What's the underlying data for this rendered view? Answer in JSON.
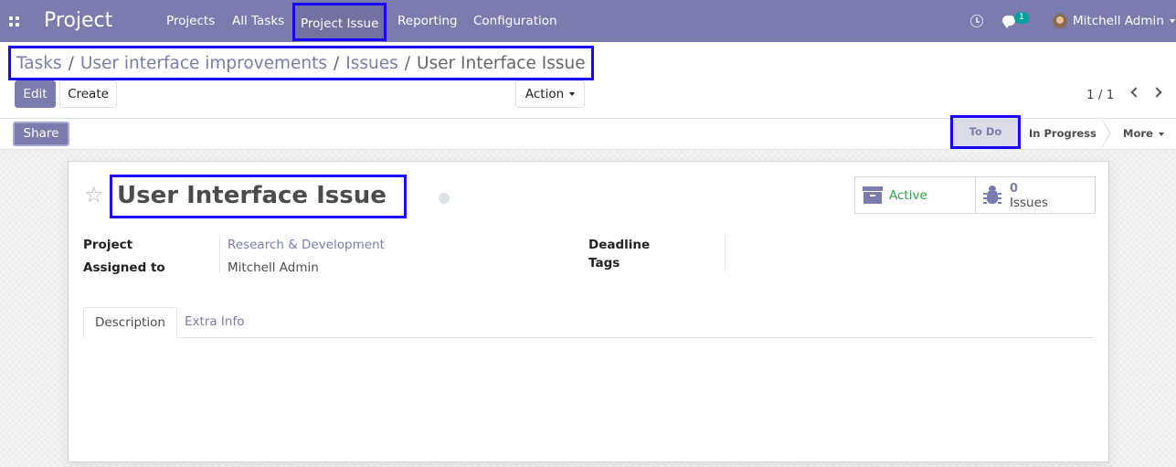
{
  "navbar": {
    "apps_icon": "apps-grid-icon",
    "brand": "Project",
    "menu": [
      "Projects",
      "All Tasks",
      "Project Issue",
      "Reporting",
      "Configuration"
    ],
    "activity_icon": "clock-icon",
    "chat_icon": "chat-icon",
    "chat_badge": "1",
    "user": "Mitchell Admin"
  },
  "breadcrumb": {
    "items": [
      "Tasks",
      "User interface improvements",
      "Issues"
    ],
    "separator": "/",
    "active": "User Interface Issue"
  },
  "buttons": {
    "edit": "Edit",
    "create": "Create",
    "action": "Action",
    "share": "Share"
  },
  "pager": {
    "value": "1 / 1"
  },
  "stages": {
    "current": "To Do",
    "next": "In Progress",
    "more": "More"
  },
  "record": {
    "title": "User Interface Issue",
    "smart_buttons": {
      "active_label": "Active",
      "issues_count": "0",
      "issues_label": "Issues"
    },
    "fields": {
      "project_label": "Project",
      "project_value": "Research & Development",
      "assigned_label": "Assigned to",
      "assigned_value": "Mitchell Admin",
      "deadline_label": "Deadline",
      "tags_label": "Tags"
    },
    "tabs": [
      "Description",
      "Extra Info"
    ]
  },
  "colors": {
    "brand": "#7c7bad",
    "highlight_border": "#1a00ff",
    "success": "#28a745",
    "badge": "#00a09d"
  }
}
